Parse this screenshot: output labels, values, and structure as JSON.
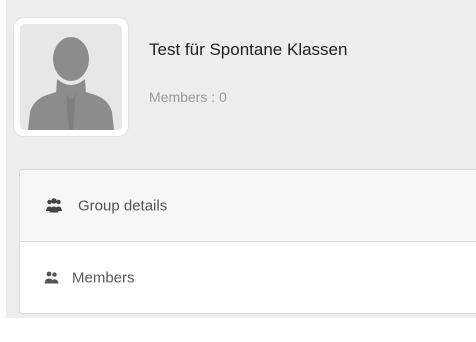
{
  "group": {
    "title": "Test für Spontane Klassen",
    "members": "Members : 0",
    "avatar_icon": "default-avatar-silhouette"
  },
  "menu": {
    "items": [
      {
        "label": "Group details",
        "icon": "group-icon"
      },
      {
        "label": "Members",
        "icon": "members-icon"
      }
    ]
  },
  "colors": {
    "panel_bg": "#ededed",
    "title": "#222222",
    "muted": "#9a9a9a",
    "menu_text": "#555555",
    "border": "#dcdcdc"
  }
}
